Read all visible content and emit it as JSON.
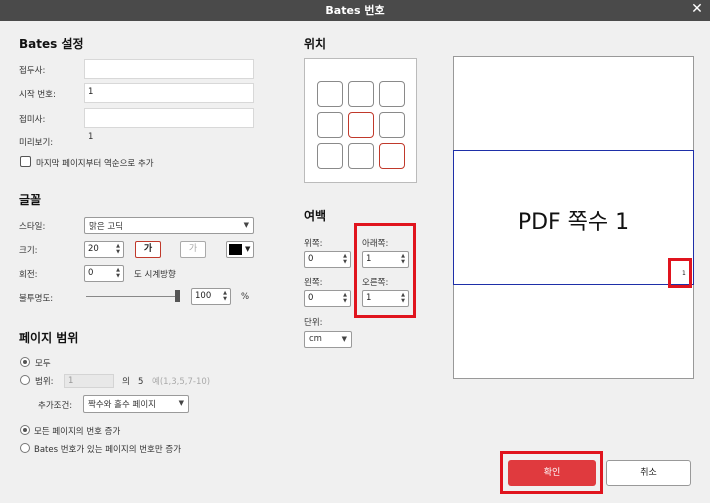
{
  "window": {
    "title": "Bates 번호",
    "close": "✕"
  },
  "settings": {
    "title": "Bates 설정",
    "prefix_label": "접두사:",
    "prefix_value": "",
    "start_label": "시작 번호:",
    "start_value": "1",
    "suffix_label": "접미사:",
    "suffix_value": "",
    "preview_label": "미리보기:",
    "preview_value": "1",
    "reverse_label": "마지막 페이지부터 역순으로 추가"
  },
  "font": {
    "title": "글꼴",
    "style_label": "스타일:",
    "style_value": "맑은 고딕",
    "size_label": "크기:",
    "size_value": "20",
    "bold_label": "가",
    "italic_label": "가",
    "color": "#000000",
    "rotate_label": "회전:",
    "rotate_value": "0",
    "rotate_unit": "도 시계방향",
    "opacity_label": "불투명도:",
    "opacity_value": "100",
    "opacity_unit": "%",
    "opacity_level": 1.0
  },
  "position": {
    "title": "위치",
    "active_cells": [
      4,
      8
    ]
  },
  "margin": {
    "title": "여백",
    "top_label": "위쪽:",
    "top_value": "0",
    "bottom_label": "아래쪽:",
    "bottom_value": "1",
    "left_label": "왼쪽:",
    "left_value": "0",
    "right_label": "오른쪽:",
    "right_value": "1",
    "unit_label": "단위:",
    "unit_value": "cm"
  },
  "range": {
    "title": "페이지 범위",
    "all_label": "모두",
    "range_label": "범위:",
    "range_value": "1",
    "of_label": "의",
    "total": "5",
    "example": "예(1,3,5,7-10)",
    "condition_label": "추가조건:",
    "condition_value": "짝수와 홀수 페이지",
    "increase_all_label": "모든 페이지의 번호 증가",
    "increase_bates_label": "Bates 번호가 있는 페이지의 번호만 증가"
  },
  "preview": {
    "page_text": "PDF 쪽수 1",
    "number": "1"
  },
  "buttons": {
    "ok": "확인",
    "cancel": "취소"
  }
}
